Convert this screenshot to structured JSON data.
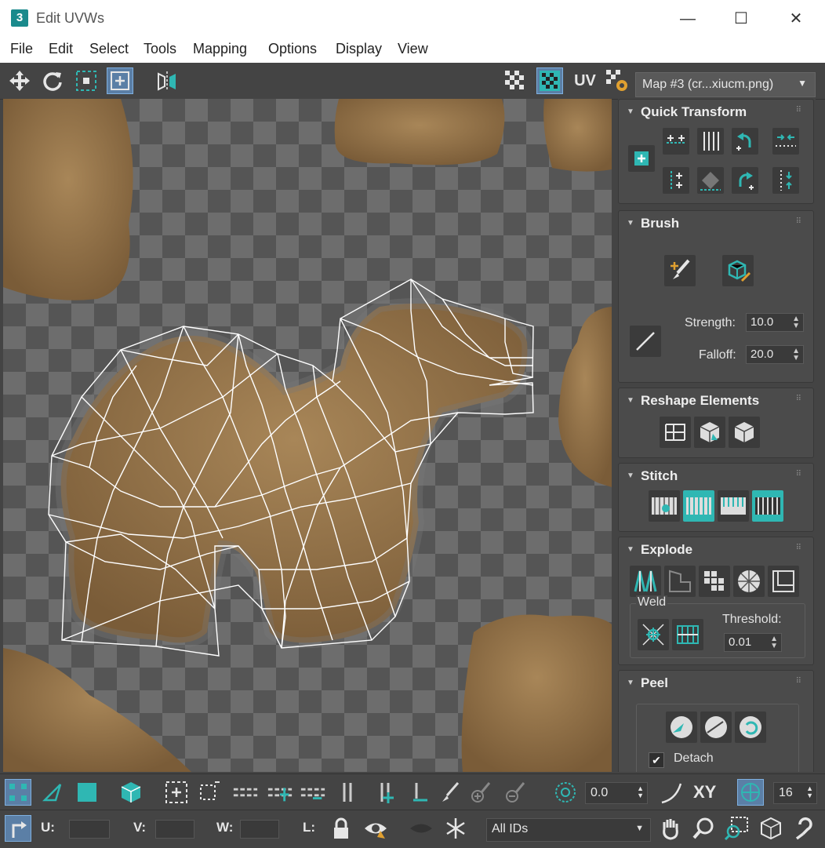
{
  "window": {
    "title": "Edit UVWs",
    "app_icon": "3",
    "minimize": "—",
    "maximize": "☐",
    "close": "✕"
  },
  "menu": [
    "File",
    "Edit",
    "Select",
    "Tools",
    "Mapping",
    "Options",
    "Display",
    "View"
  ],
  "toolbar": {
    "uv_label": "UV",
    "map_select": "Map #3 (cr...xiucm.png)"
  },
  "panel": {
    "quick_transform": "Quick Transform",
    "brush": "Brush",
    "strength_label": "Strength:",
    "strength_value": "10.0",
    "falloff_label": "Falloff:",
    "falloff_value": "20.0",
    "reshape": "Reshape Elements",
    "stitch": "Stitch",
    "explode": "Explode",
    "weld": "Weld",
    "threshold_label": "Threshold:",
    "threshold_value": "0.01",
    "peel": "Peel",
    "detach": "Detach"
  },
  "bottom": {
    "rotation_value": "0.0",
    "xy_label": "XY",
    "grid_value": "16",
    "u_label": "U:",
    "v_label": "V:",
    "w_label": "W:",
    "l_label": "L:",
    "ids_select": "All IDs"
  },
  "colors": {
    "accent": "#2fb7b3",
    "cookie": "#8b6d45",
    "panel": "#444444"
  }
}
